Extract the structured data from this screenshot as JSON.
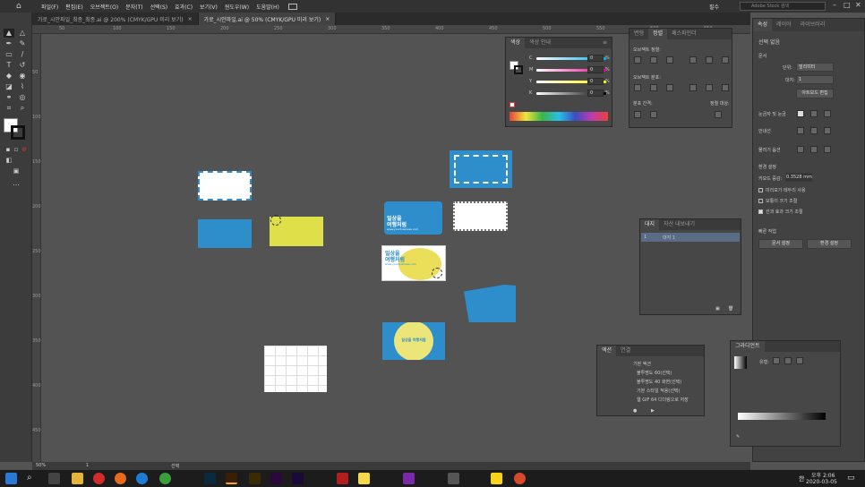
{
  "menubar": {
    "items": [
      "파일(F)",
      "편집(E)",
      "오브젝트(O)",
      "문자(T)",
      "선택(S)",
      "효과(C)",
      "보기(V)",
      "윈도우(W)",
      "도움말(H)"
    ],
    "workspace": "필수",
    "search_placeholder": "Adobe Stock 검색"
  },
  "tabs": [
    {
      "label": "가로_시안파일_최종_최종.ai @ 200% (CMYK/GPU 미리 보기)"
    },
    {
      "label": "가로_시안파일.ai @ 50% (CMYK/GPU 미리 보기)"
    }
  ],
  "ruler": {
    "top": [
      "50",
      "100",
      "150",
      "200",
      "250",
      "300",
      "350",
      "400",
      "450",
      "500",
      "550",
      "600",
      "650"
    ],
    "left": [
      "50",
      "100",
      "150",
      "200",
      "250",
      "300",
      "350",
      "400",
      "450"
    ]
  },
  "artboard": {
    "card1": {
      "title_line1": "일상을",
      "title_line2": "여행처럼",
      "subtitle": "www.yourbusiness.com"
    },
    "card2": {
      "title_line1": "일상을",
      "title_line2": "여행처럼",
      "subtitle": "www.yourbusiness.com"
    },
    "card3": {
      "title": "일상을 여행처럼"
    }
  },
  "color_panel": {
    "tabs": [
      "색상",
      "색상 안내"
    ],
    "channels": [
      "C",
      "M",
      "Y",
      "K"
    ],
    "values": [
      "0",
      "0",
      "0",
      "0"
    ],
    "unit": "%"
  },
  "align_panel": {
    "tabs": [
      "변형",
      "정렬",
      "패스파인더"
    ],
    "align_objects": "오브젝트 정렬:",
    "distribute_objects": "오브젝트 분포:",
    "distribute_spacing": "분포 간격:",
    "align_to": "정렬 대상:"
  },
  "props_panel": {
    "tabs": [
      "속성",
      "레이어",
      "라이브러리"
    ],
    "no_selection": "선택 없음",
    "document": "문서",
    "units_label": "단위:",
    "units": "밀리미터",
    "artboard_label": "대지:",
    "artboard_value": "1",
    "edit_artboards": "아트보드 편집",
    "ruler_grid": "눈금자 및 눈금",
    "guides": "안내선",
    "snap": "물리기 옵션",
    "preferences": "환경 설정",
    "keyboard_increment_label": "키보드 증감:",
    "keyboard_increment": "0.3528 mm",
    "opt1": "미리보기 테두리 사용",
    "opt2": "모퉁이 크기 조절",
    "opt3": "선과 효과 크기 조절",
    "quick_actions": "빠른 작업",
    "doc_setup": "문서 설정",
    "prefs_button": "환경 설정"
  },
  "artboards_panel": {
    "tabs": [
      "대지",
      "자산 내보내기"
    ],
    "rows": [
      {
        "num": "1",
        "name": "대지 1"
      }
    ]
  },
  "actions_panel": {
    "tabs": [
      "액션",
      "연결"
    ],
    "rows": [
      "기본 액션",
      "불투명도 60(선택)",
      "불투명도 40 화면(선택)",
      "기본 스타일 적용(선택)",
      "웹 GIF 64 디더링으로 저장"
    ]
  },
  "gradient_panel": {
    "title": "그라디언트",
    "type_label": "유형:"
  },
  "status": {
    "zoom": "50%",
    "artboard": "1",
    "tool": "선택"
  },
  "taskbar": {
    "time": "오후 2:06",
    "date": "2020-03-05",
    "lang": "한"
  },
  "colors": {
    "blue": "#2d8ecb",
    "yellow": "#dfdf4a"
  }
}
